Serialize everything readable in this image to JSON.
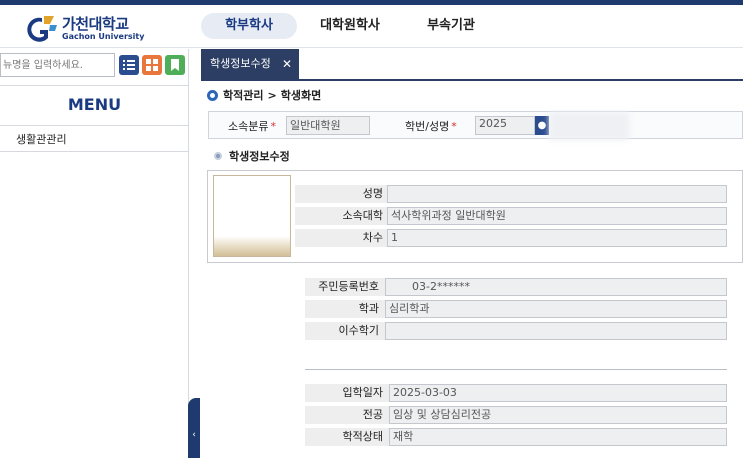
{
  "header": {
    "logo_ko": "가천대학교",
    "logo_en": "Gachon University",
    "nav": [
      "학부학사",
      "대학원학사",
      "부속기관"
    ]
  },
  "sidebar": {
    "search_placeholder": "뉴명을 입력하세요.",
    "menu_title": "MENU",
    "items": [
      "생활관관리"
    ]
  },
  "tab": {
    "label": "학생정보수정",
    "close": "✕"
  },
  "breadcrumb": {
    "parent": "학적관리",
    "sep": ">",
    "current": "학생화면"
  },
  "filter": {
    "affil_label": "소속분류",
    "affil_value": "일반대학원",
    "id_label": "학번/성명",
    "id_value": "2025",
    "required_mark": "*"
  },
  "section_title": "학생정보수정",
  "fields": {
    "name_label": "성명",
    "name_value": "",
    "college_label": "소속대학",
    "college_value": "석사학위과정 일반대학원",
    "grade_label": "차수",
    "grade_value": "1",
    "rrn_label": "주민등록번호",
    "rrn_value": "03-2******",
    "dept_label": "학과",
    "dept_value": "심리학과",
    "semester_label": "이수학기",
    "semester_value": "",
    "admit_label": "입학일자",
    "admit_value": "2025-03-03",
    "major_label": "전공",
    "major_value": "임상 및 상담심리전공",
    "status_label": "학적상태",
    "status_value": "재학"
  },
  "colors": {
    "brand": "#1a3a82",
    "tab_bg": "#2c3e63",
    "required": "#d23030"
  }
}
